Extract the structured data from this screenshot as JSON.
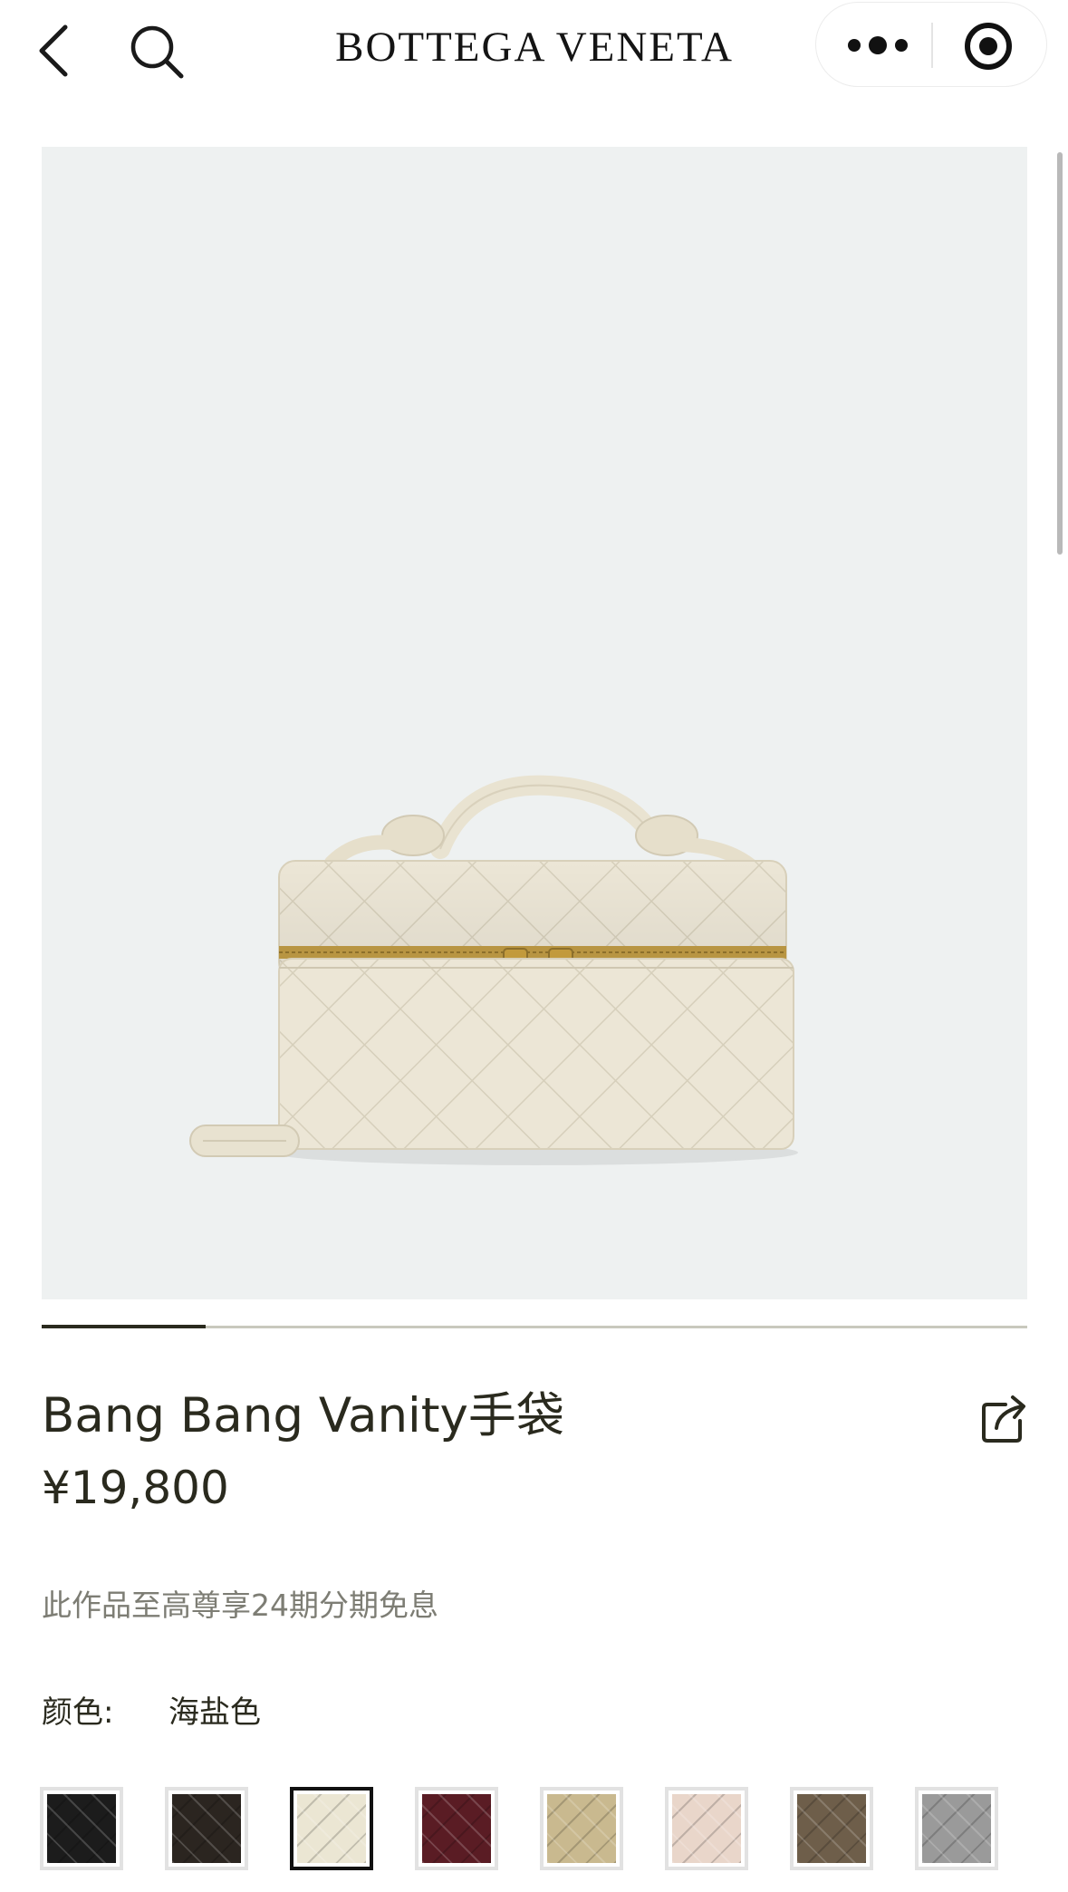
{
  "header": {
    "brand": "BOTTEGA VENETA",
    "back_icon": "chevron-left-icon",
    "search_icon": "search-icon",
    "more_icon": "more-dots-icon",
    "target_icon": "record-target-icon"
  },
  "gallery": {
    "image_alt": "Bang Bang Vanity手袋",
    "background": "#eef1f1",
    "active_index": 1,
    "total_images": 6
  },
  "product": {
    "title": "Bang Bang Vanity手袋",
    "price": "¥19,800",
    "installment_note": "此作品至高尊享24期分期免息",
    "share_icon": "share-icon"
  },
  "color": {
    "label": "颜色:",
    "selected_name": "海盐色",
    "swatches": [
      {
        "color": "#1c1c1c",
        "selected": false
      },
      {
        "color": "#2b2520",
        "selected": false
      },
      {
        "color": "#ebe6d3",
        "selected": true
      },
      {
        "color": "#5a1c24",
        "selected": false
      },
      {
        "color": "#c9b98f",
        "selected": false
      },
      {
        "color": "#e9d6ca",
        "selected": false
      },
      {
        "color": "#6e5e4a",
        "selected": false
      },
      {
        "color": "#9a9a9a",
        "selected": false
      }
    ]
  },
  "colors": {
    "text": "#2a2a1e",
    "muted": "#7d7d74",
    "image_bg": "#eef1f1"
  }
}
